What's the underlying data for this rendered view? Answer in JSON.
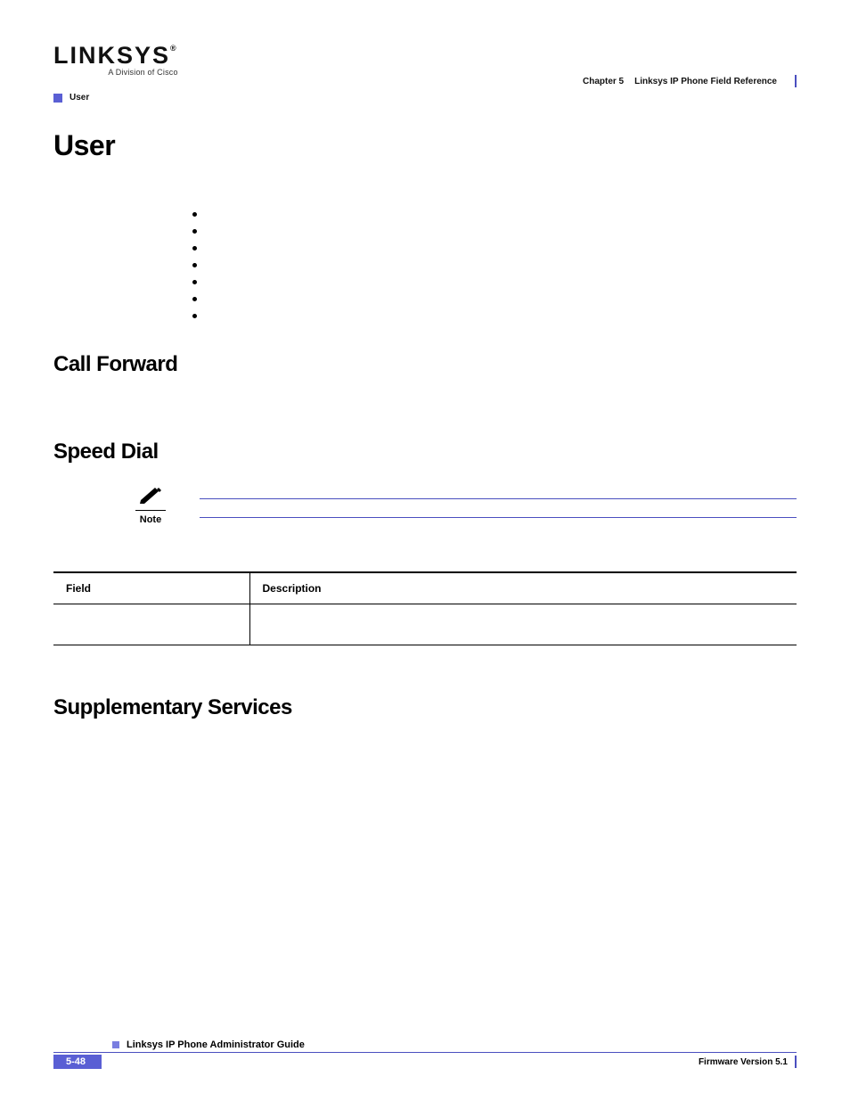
{
  "logo": {
    "brand": "LINKSYS",
    "reg": "®",
    "tag": "A Division of Cisco"
  },
  "chapter": {
    "number": "Chapter 5",
    "title": "Linksys IP Phone Field Reference"
  },
  "breadcrumb": "User",
  "h1": "User",
  "sections": {
    "call_forward": "Call Forward",
    "speed_dial": "Speed Dial",
    "supplementary": "Supplementary Services"
  },
  "note_label": "Note",
  "table": {
    "headers": {
      "field": "Field",
      "description": "Description"
    },
    "rows": [
      {
        "field": "",
        "description": ""
      }
    ]
  },
  "footer": {
    "guide": "Linksys IP Phone Administrator Guide",
    "page": "5-48",
    "firmware": "Firmware Version 5.1"
  }
}
